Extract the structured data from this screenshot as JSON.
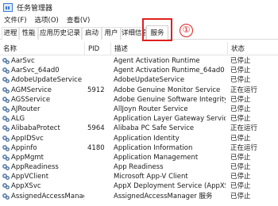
{
  "window": {
    "title": "任务管理器",
    "icon": "task-manager-icon"
  },
  "menu": [
    {
      "label": "文件(F)"
    },
    {
      "label": "选项(O)"
    },
    {
      "label": "查看(V)"
    }
  ],
  "tabs": [
    {
      "label": "进程"
    },
    {
      "label": "性能"
    },
    {
      "label": "应用历史记录"
    },
    {
      "label": "启动"
    },
    {
      "label": "用户"
    },
    {
      "label": "详细信息"
    },
    {
      "label": "服务",
      "active": true
    }
  ],
  "annotation": {
    "marker": "①",
    "color": "#e02020"
  },
  "table": {
    "columns": {
      "name": "名称",
      "pid": "PID",
      "desc": "描述",
      "status": "状态"
    },
    "rows": [
      {
        "name": "AarSvc",
        "pid": "",
        "desc": "Agent Activation Runtime",
        "status": "已停止"
      },
      {
        "name": "AarSvc_64ad0",
        "pid": "",
        "desc": "Agent Activation Runtime_64ad0",
        "status": "已停止"
      },
      {
        "name": "AdobeUpdateService",
        "pid": "",
        "desc": "AdobeUpdateService",
        "status": "已停止"
      },
      {
        "name": "AGMService",
        "pid": "5912",
        "desc": "Adobe Genuine Monitor Service",
        "status": "正在运行"
      },
      {
        "name": "AGSService",
        "pid": "",
        "desc": "Adobe Genuine Software Integrity ...",
        "status": "已停止"
      },
      {
        "name": "AJRouter",
        "pid": "",
        "desc": "AllJoyn Router Service",
        "status": "已停止"
      },
      {
        "name": "ALG",
        "pid": "",
        "desc": "Application Layer Gateway Service",
        "status": "已停止"
      },
      {
        "name": "AlibabaProtect",
        "pid": "5964",
        "desc": "Alibaba PC Safe Service",
        "status": "正在运行"
      },
      {
        "name": "AppIDSvc",
        "pid": "",
        "desc": "Application Identity",
        "status": "已停止"
      },
      {
        "name": "Appinfo",
        "pid": "4180",
        "desc": "Application Information",
        "status": "正在运行"
      },
      {
        "name": "AppMgmt",
        "pid": "",
        "desc": "Application Management",
        "status": "已停止"
      },
      {
        "name": "AppReadiness",
        "pid": "",
        "desc": "App Readiness",
        "status": "已停止"
      },
      {
        "name": "AppVClient",
        "pid": "",
        "desc": "Microsoft App-V Client",
        "status": "已停止"
      },
      {
        "name": "AppXSvc",
        "pid": "",
        "desc": "AppX Deployment Service (AppXSV...",
        "status": "已停止"
      },
      {
        "name": "AssignedAccessManagerSvc",
        "pid": "",
        "desc": "AssignedAccessManager 服务",
        "status": "已停止"
      }
    ]
  }
}
